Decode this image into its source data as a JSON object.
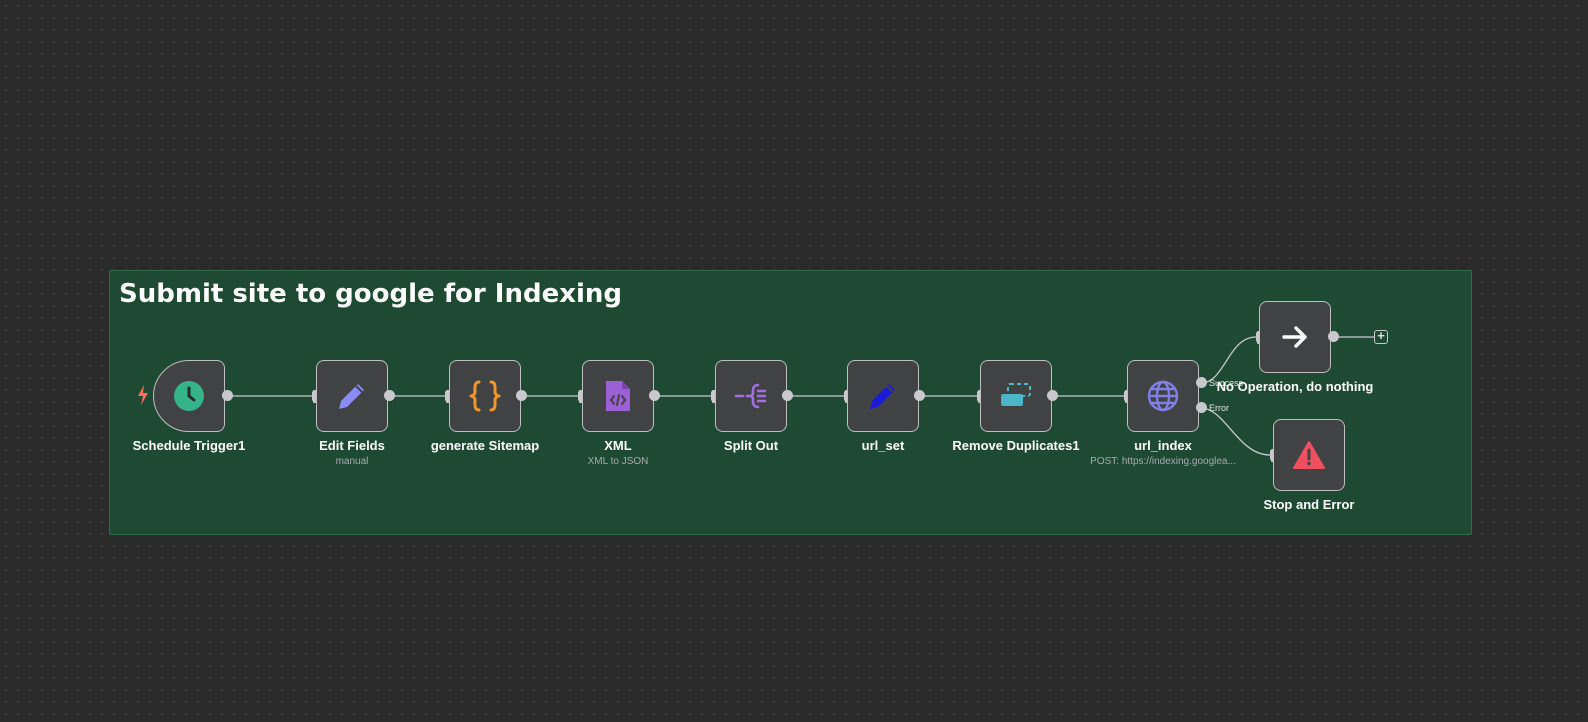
{
  "sticky": {
    "title": "Submit site to google for Indexing"
  },
  "nodes": {
    "schedule": {
      "label": "Schedule Trigger1"
    },
    "edit_fields": {
      "label": "Edit Fields",
      "sub": "manual"
    },
    "sitemap": {
      "label": "generate Sitemap"
    },
    "xml": {
      "label": "XML",
      "sub": "XML to JSON"
    },
    "split_out": {
      "label": "Split Out"
    },
    "url_set": {
      "label": "url_set"
    },
    "remove_dup": {
      "label": "Remove Duplicates1"
    },
    "url_index": {
      "label": "url_index",
      "sub": "POST: https://indexing.googlea..."
    },
    "noop": {
      "label": "No Operation, do nothing"
    },
    "stop_error": {
      "label": "Stop and Error"
    }
  },
  "handles": {
    "success": "Success",
    "error": "Error"
  },
  "add_button": "+",
  "colors": {
    "sticky_bg": "#1e4a33",
    "schedule_icon": "#35b48a",
    "edit_icon": "#8a8cf5",
    "code_icon": "#f0962c",
    "xml_icon": "#9b5fd6",
    "split_icon": "#a06ee0",
    "url_set_icon": "#1a1ad8",
    "dup_icon": "#4ab6c8",
    "http_icon": "#7f7fe6",
    "error_icon": "#ef4f5e"
  },
  "icons": [
    "clock-icon",
    "pencil-icon",
    "code-braces-icon",
    "xml-file-icon",
    "split-icon",
    "pencil-icon",
    "remove-duplicates-icon",
    "globe-icon",
    "arrow-right-icon",
    "warning-icon",
    "bolt-icon"
  ]
}
